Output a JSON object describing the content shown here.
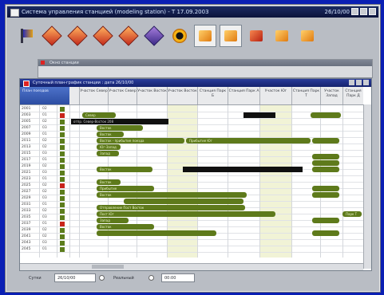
{
  "window": {
    "title": "Система управления станцией (modeling station) - Т 17.09.2003",
    "date": "26/10/00"
  },
  "toolbar": {
    "tools": [
      {
        "icon": "flag-icon",
        "selected": false
      },
      {
        "icon": "red-diamond-icon",
        "selected": false
      },
      {
        "icon": "red-diamond-icon",
        "selected": false
      },
      {
        "icon": "red-diamond-icon",
        "selected": false
      },
      {
        "icon": "red-diamond-icon",
        "selected": false
      },
      {
        "icon": "violet-diamond-icon",
        "selected": false
      },
      {
        "icon": "bullseye-icon",
        "selected": false
      },
      {
        "icon": "yellow-square-icon",
        "selected": true
      },
      {
        "icon": "yellow-square-icon",
        "selected": true
      },
      {
        "icon": "red-square-icon",
        "selected": false
      },
      {
        "icon": "yellow-square-icon",
        "selected": false
      },
      {
        "icon": "yellow-square-icon",
        "selected": false
      }
    ]
  },
  "background_window": {
    "title": "Окно станции"
  },
  "main_window": {
    "title": "Суточный план-график станции : дата 26/10/00",
    "left_header": "План поездов",
    "columns": [
      "Участок Север",
      "Участок Север",
      "Участок Восток",
      "Участок Восток",
      "Станция Парк Б",
      "Станция Парк А",
      "Участок Юг",
      "Станция Парк Т",
      "Участок Запад",
      "Станция Парк Д"
    ],
    "rows": [
      {
        "label": "2001",
        "code": "02"
      },
      {
        "label": "2003",
        "code": "01"
      },
      {
        "label": "2005",
        "code": "02"
      },
      {
        "label": "2007",
        "code": "03"
      },
      {
        "label": "2009",
        "code": "01"
      },
      {
        "label": "2011",
        "code": "02"
      },
      {
        "label": "2013",
        "code": "02"
      },
      {
        "label": "2015",
        "code": "03"
      },
      {
        "label": "2017",
        "code": "01"
      },
      {
        "label": "2019",
        "code": "02"
      },
      {
        "label": "2021",
        "code": "03"
      },
      {
        "label": "2023",
        "code": "01"
      },
      {
        "label": "2025",
        "code": "02"
      },
      {
        "label": "2027",
        "code": "02"
      },
      {
        "label": "2029",
        "code": "03"
      },
      {
        "label": "2031",
        "code": "01"
      },
      {
        "label": "2033",
        "code": "02"
      },
      {
        "label": "2035",
        "code": "03"
      },
      {
        "label": "2037",
        "code": "01"
      },
      {
        "label": "2039",
        "code": "02"
      },
      {
        "label": "2041",
        "code": "02"
      },
      {
        "label": "2043",
        "code": "03"
      },
      {
        "label": "2045",
        "code": "01"
      }
    ],
    "bar_labels": {
      "b1": "Север",
      "b2": "отпр. Север-Восток 208",
      "b3": "Восток",
      "b4": "Восток",
      "b5": "Восток - прибытие поезда",
      "b6": "Прибытие Юг",
      "b7": "Юг-Запад",
      "b8": "Запад",
      "b9": "Восток",
      "b10": "Восток",
      "b11": "Прибытие",
      "b12": "Восток",
      "b13": "Отправление Пост Восток",
      "b14": "Пост Юг",
      "b15": "Запад",
      "b16": "Восток",
      "b17": "Парк Т"
    }
  },
  "statusbar": {
    "date_label": "Сутки",
    "date_value": "26/10/00",
    "mode_label": "Реальный",
    "time_value": "00:00"
  }
}
